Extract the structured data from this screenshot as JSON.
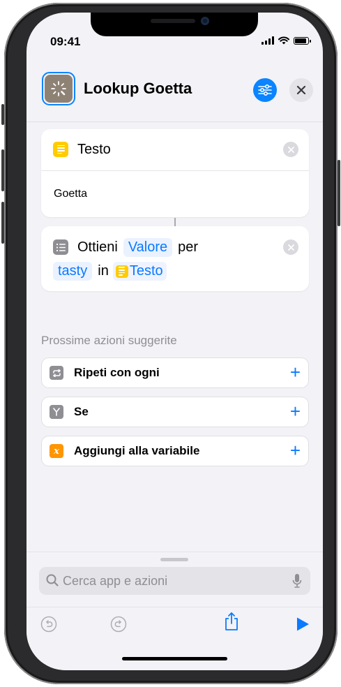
{
  "status_bar": {
    "time": "09:41"
  },
  "header": {
    "title": "Lookup Goetta",
    "app_icon": "magic-wand-icon",
    "settings_icon": "sliders-icon",
    "close_icon": "close-icon"
  },
  "actions": [
    {
      "title": "Testo",
      "icon": "text-icon",
      "body": "Goetta"
    },
    {
      "verb": "Ottieni",
      "value_token": "Valore",
      "per": "per",
      "key_token": "tasty",
      "in": "in",
      "var_token": "Testo",
      "icon": "list-icon"
    }
  ],
  "suggestions": {
    "label": "Prossime azioni suggerite",
    "items": [
      {
        "label": "Ripeti con ogni",
        "icon": "repeat-icon",
        "color": "#8e8e93"
      },
      {
        "label": "Se",
        "icon": "branch-icon",
        "color": "#8e8e93"
      },
      {
        "label": "Aggiungi alla variabile",
        "icon": "variable-icon",
        "color": "#ff9500"
      }
    ]
  },
  "search": {
    "placeholder": "Cerca app e azioni"
  },
  "colors": {
    "accent": "#0a7aff",
    "variable_yellow": "#ffcc00"
  }
}
